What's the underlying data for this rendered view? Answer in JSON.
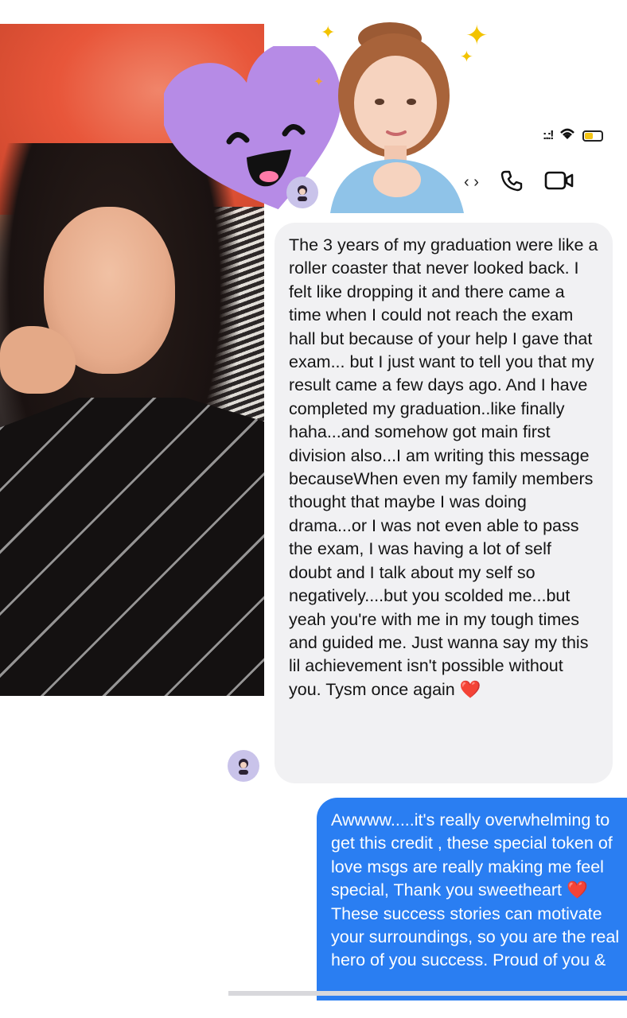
{
  "messages": {
    "incoming": {
      "text": "The 3 years of my graduation were like a roller coaster that never looked back. I felt like dropping it and there came a time when I could not reach the exam hall but because of your help I gave that exam... but I just want to tell you that my result came a few days ago. And I have completed my graduation..like finally haha...and somehow got main first division also...I am writing this message becauseWhen even my family members thought that maybe I was doing drama...or I was not even able to pass the exam, I was having a lot of self doubt and I talk about my self so  negatively....but you scolded me...but yeah you're with me in my tough times and guided me. Just wanna say my this lil achievement isn't possible without you. Tysm once again",
      "emoji": "❤️"
    },
    "outgoing": {
      "text_before_emoji": "Awwww.....it's really overwhelming to get this credit , these special token of love msgs are really making me feel special, Thank you sweetheart",
      "emoji": "❤️",
      "text_after_emoji": "These success stories can motivate your surroundings, so you are the real hero of you success. Proud of you &"
    }
  },
  "status_bar": {
    "signal": ":.:!",
    "wifi_icon": "wifi-icon",
    "battery_level": 0.35
  },
  "header": {
    "chevron": "‹ ›",
    "icons": [
      "phone-icon",
      "video-call-icon"
    ]
  },
  "colors": {
    "incoming_bubble": "#f1f1f3",
    "outgoing_bubble": "#2a7ef2",
    "heart_sticker": "#b68be6",
    "avatar_bg": "#c9c3ea"
  }
}
